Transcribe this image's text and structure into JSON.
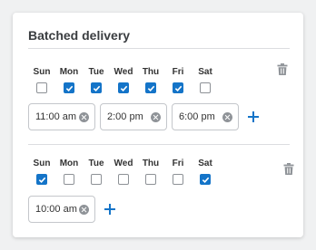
{
  "card": {
    "title": "Batched delivery"
  },
  "colors": {
    "accent": "#1474c8",
    "muted": "#8f9398"
  },
  "schedules": [
    {
      "days": [
        {
          "label": "Sun",
          "checked": false
        },
        {
          "label": "Mon",
          "checked": true
        },
        {
          "label": "Tue",
          "checked": true
        },
        {
          "label": "Wed",
          "checked": true
        },
        {
          "label": "Thu",
          "checked": true
        },
        {
          "label": "Fri",
          "checked": true
        },
        {
          "label": "Sat",
          "checked": false
        }
      ],
      "times": [
        "11:00 am",
        "2:00 pm",
        "6:00 pm"
      ],
      "delete_icon": "trash-icon",
      "add_icon": "plus-icon"
    },
    {
      "days": [
        {
          "label": "Sun",
          "checked": true
        },
        {
          "label": "Mon",
          "checked": false
        },
        {
          "label": "Tue",
          "checked": false
        },
        {
          "label": "Wed",
          "checked": false
        },
        {
          "label": "Thu",
          "checked": false
        },
        {
          "label": "Fri",
          "checked": false
        },
        {
          "label": "Sat",
          "checked": true
        }
      ],
      "times": [
        "10:00 am"
      ],
      "delete_icon": "trash-icon",
      "add_icon": "plus-icon"
    }
  ]
}
